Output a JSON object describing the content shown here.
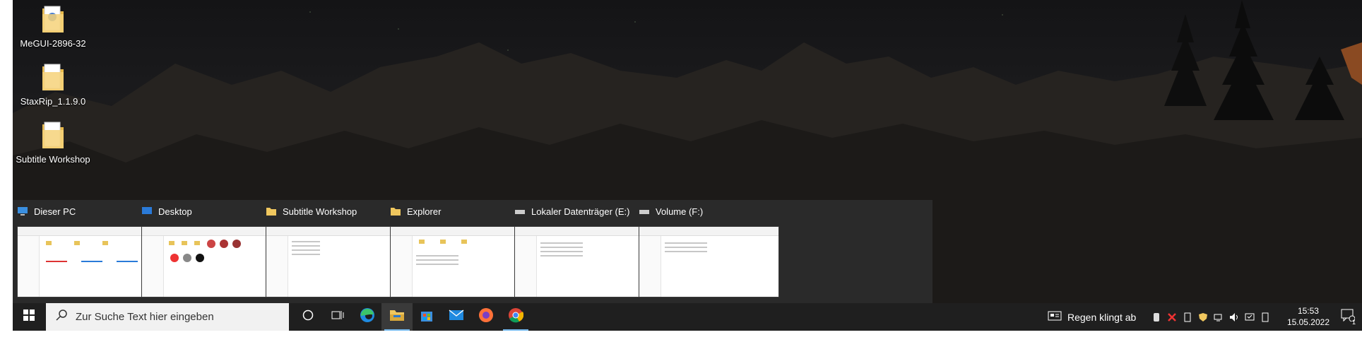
{
  "desktop": {
    "icons": [
      {
        "label": "MeGUI-2896-32"
      },
      {
        "label": "StaxRip_1.1.9.0"
      },
      {
        "label": "Subtitle Workshop"
      }
    ]
  },
  "thumbnails": [
    {
      "title": "Dieser PC",
      "icon": "computer-icon"
    },
    {
      "title": "Desktop",
      "icon": "desktop-icon"
    },
    {
      "title": "Subtitle Workshop",
      "icon": "folder-icon"
    },
    {
      "title": "Explorer",
      "icon": "folder-icon"
    },
    {
      "title": "Lokaler Datenträger (E:)",
      "icon": "drive-icon"
    },
    {
      "title": "Volume (F:)",
      "icon": "drive-icon"
    }
  ],
  "taskbar": {
    "search_placeholder": "Zur Suche Text hier eingeben",
    "apps": [
      "start-icon",
      "cortana-icon",
      "task-view-icon",
      "edge-icon",
      "file-explorer-icon",
      "store-icon",
      "mail-icon",
      "firefox-icon",
      "chrome-icon"
    ],
    "weather": "Regen klingt ab",
    "time": "15:53",
    "date": "15.05.2022",
    "notification_count": "1"
  },
  "colors": {
    "taskbar_bg": "#1f1f1f",
    "thumbstrip_bg": "#2a2a2a",
    "folder": "#f0c75e",
    "accent": "#76b9ed"
  }
}
